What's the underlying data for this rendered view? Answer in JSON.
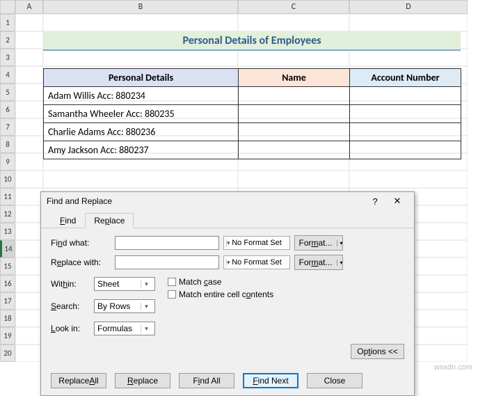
{
  "columns": [
    "A",
    "B",
    "C",
    "D"
  ],
  "rows": [
    "1",
    "2",
    "3",
    "4",
    "5",
    "6",
    "7",
    "8",
    "9",
    "10",
    "11",
    "12",
    "13",
    "14",
    "15",
    "16",
    "17",
    "18",
    "19",
    "20"
  ],
  "selected_row": "14",
  "title": "Personal Details of Employees",
  "table": {
    "headers": {
      "details": "Personal Details",
      "name": "Name",
      "account": "Account Number"
    },
    "rows": [
      {
        "details": "Adam Willis Acc: 880234",
        "name": "",
        "account": ""
      },
      {
        "details": "Samantha Wheeler Acc: 880235",
        "name": "",
        "account": ""
      },
      {
        "details": "Charlie Adams Acc: 880236",
        "name": "",
        "account": ""
      },
      {
        "details": "Amy Jackson Acc: 880237",
        "name": "",
        "account": ""
      }
    ]
  },
  "dialog": {
    "title": "Find and Replace",
    "tabs": {
      "find": "Find",
      "replace": "Replace"
    },
    "labels": {
      "find_what": "Find what:",
      "replace_with": "Replace with:",
      "within": "Within:",
      "search": "Search:",
      "look_in": "Look in:"
    },
    "values": {
      "find_what": "",
      "replace_with": "",
      "within": "Sheet",
      "search": "By Rows",
      "look_in": "Formulas"
    },
    "format_status": "No Format Set",
    "format_button": "Format...",
    "checkboxes": {
      "match_case": "Match case",
      "match_entire": "Match entire cell contents"
    },
    "options_button": "Options <<",
    "buttons": {
      "replace_all": "Replace All",
      "replace": "Replace",
      "find_all": "Find All",
      "find_next": "Find Next",
      "close": "Close"
    }
  },
  "watermark": "wsxdn.com",
  "chart_data": {
    "type": "table",
    "title": "Personal Details of Employees",
    "headers": [
      "Personal Details",
      "Name",
      "Account Number"
    ],
    "rows": [
      [
        "Adam Willis Acc: 880234",
        "",
        ""
      ],
      [
        "Samantha Wheeler Acc: 880235",
        "",
        ""
      ],
      [
        "Charlie Adams Acc: 880236",
        "",
        ""
      ],
      [
        "Amy Jackson Acc: 880237",
        "",
        ""
      ]
    ]
  }
}
